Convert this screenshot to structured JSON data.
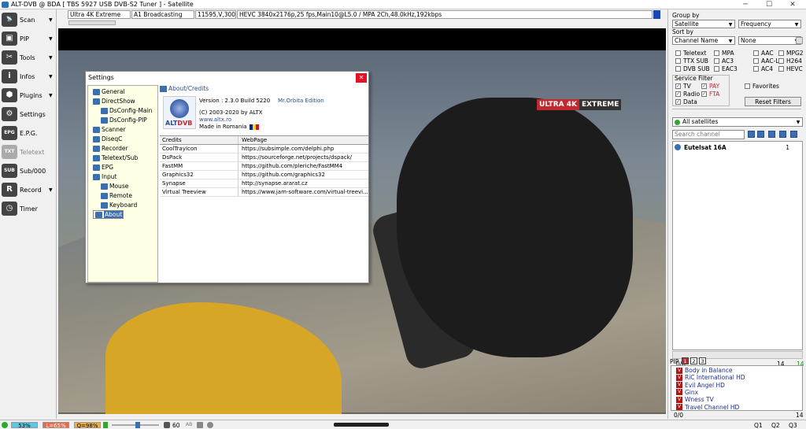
{
  "window": {
    "title": "ALT-DVB @ BDA [ TBS 5927 USB DVB-S2 Tuner ] - Satellite",
    "minimize": "─",
    "maximize": "☐",
    "close": "✕"
  },
  "toolbar": [
    {
      "label": "Scan",
      "icon": "satellite-dish-icon",
      "glyph": "📡",
      "arrow": "▼"
    },
    {
      "label": "PIP",
      "icon": "pip-icon",
      "glyph": "▣",
      "arrow": "▼"
    },
    {
      "label": "Tools",
      "icon": "tools-icon",
      "glyph": "✂",
      "arrow": "▼"
    },
    {
      "label": "Infos",
      "icon": "info-icon",
      "glyph": "i",
      "arrow": "▼"
    },
    {
      "label": "Plugins",
      "icon": "plugin-icon",
      "glyph": "⬢",
      "arrow": "▼"
    },
    {
      "label": "Settings",
      "icon": "gear-icon",
      "glyph": "⚙",
      "arrow": ""
    },
    {
      "label": "E.P.G.",
      "icon": "epg-icon",
      "glyph": "EPG",
      "arrow": ""
    },
    {
      "label": "Teletext",
      "icon": "teletext-icon",
      "glyph": "TXT",
      "arrow": ""
    },
    {
      "label": "Sub/000",
      "icon": "subtitle-icon",
      "glyph": "SUB",
      "arrow": ""
    },
    {
      "label": "Record",
      "icon": "record-icon",
      "glyph": "R",
      "arrow": "▼"
    },
    {
      "label": "Timer",
      "icon": "timer-icon",
      "glyph": "◷",
      "arrow": ""
    }
  ],
  "infostrip": {
    "channel": "Ultra 4K Extreme",
    "provider": "A1 Broadcasting",
    "transponder": "11595,V,30000",
    "video": "HEVC 3840x2176p,25 fps,Main10@L5.0 / MPA 2Ch,48.0kHz,192kbps"
  },
  "video": {
    "logo_a": "ULTRA 4K",
    "logo_b": "EXTREME"
  },
  "settings": {
    "title": "Settings",
    "close": "✕",
    "tree": [
      {
        "label": "General",
        "indent": 0
      },
      {
        "label": "DirectShow",
        "indent": 0
      },
      {
        "label": "DsConfig-Main",
        "indent": 1
      },
      {
        "label": "DsConfig-PIP",
        "indent": 1
      },
      {
        "label": "Scanner",
        "indent": 0
      },
      {
        "label": "DiseqC",
        "indent": 0
      },
      {
        "label": "Recorder",
        "indent": 0
      },
      {
        "label": "Teletext/Sub",
        "indent": 0
      },
      {
        "label": "EPG",
        "indent": 0
      },
      {
        "label": "Input",
        "indent": 0
      },
      {
        "label": "Mouse",
        "indent": 1
      },
      {
        "label": "Remote",
        "indent": 1
      },
      {
        "label": "Keyboard",
        "indent": 1
      },
      {
        "label": "About",
        "indent": 0
      }
    ],
    "about": {
      "heading": "About/Credits",
      "logo_alt": "ALT",
      "logo_dvb": "DVB",
      "version": "Version :  2.3.0 Build 5220",
      "edition": "Mr.Orbita Edition",
      "copyright": "(C) 2003-2020 by ALTX",
      "website": "www.altx.ro",
      "made_in": "Made in Romania",
      "credits_header": [
        "Credits",
        "WebPage"
      ],
      "credits": [
        [
          "CoolTrayIcon",
          "https://subsimple.com/delphi.php"
        ],
        [
          "DsPack",
          "https://sourceforge.net/projects/dspack/"
        ],
        [
          "FastMM",
          "https://github.com/pleriche/FastMM4"
        ],
        [
          "Graphics32",
          "https://github.com/graphics32"
        ],
        [
          "Synapse",
          "http://synapse.ararat.cz"
        ],
        [
          "Virtual Treeview",
          "https://www.jam-software.com/virtual-treevi..."
        ]
      ]
    }
  },
  "right": {
    "group_by_label": "Group by",
    "group_by": "Satellite",
    "group_by2": "Frequency",
    "sort_by_label": "Sort by",
    "sort_by": "Channel Name",
    "sort_by2": "None",
    "filters": [
      [
        "Teletext",
        "MPA",
        "AAC",
        "MPG2"
      ],
      [
        "TTX SUB",
        "AC3",
        "AAC-L",
        "H264"
      ],
      [
        "DVB SUB",
        "EAC3",
        "AC4",
        "HEVC"
      ]
    ],
    "service_filter_label": "Service Filter",
    "service": [
      {
        "label": "TV",
        "checked": true,
        "red": false
      },
      {
        "label": "PAY",
        "checked": true,
        "red": true
      },
      {
        "label": "Radio",
        "checked": true,
        "red": false
      },
      {
        "label": "FTA",
        "checked": true,
        "red": true
      },
      {
        "label": "Data",
        "checked": true,
        "red": false
      }
    ],
    "favorites": "Favorites",
    "reset": "Reset Filters",
    "all_sat": "All satellites",
    "search_placeholder": "Search channel",
    "sat_name": "Eutelsat 16A",
    "sat_count": "1",
    "counter_left": "0/0",
    "counter_mid": "14",
    "counter_right": "14",
    "pip_label": "PIP",
    "pip_tabs": [
      "1",
      "2",
      "3"
    ],
    "pip_channels": [
      "Body in Balance",
      "RiC International HD",
      "Evil Angel HD",
      "Ginx",
      "Wness TV",
      "Travel Channel HD"
    ],
    "pip_counter_left": "0/0",
    "pip_counter_right": "14"
  },
  "status": {
    "s": "53%",
    "l": "L=65%",
    "q": "Q=98%",
    "volume": "60",
    "ab": "AB",
    "zoom1": "Q1",
    "zoom2": "Q2",
    "zoom3": "Q3"
  }
}
